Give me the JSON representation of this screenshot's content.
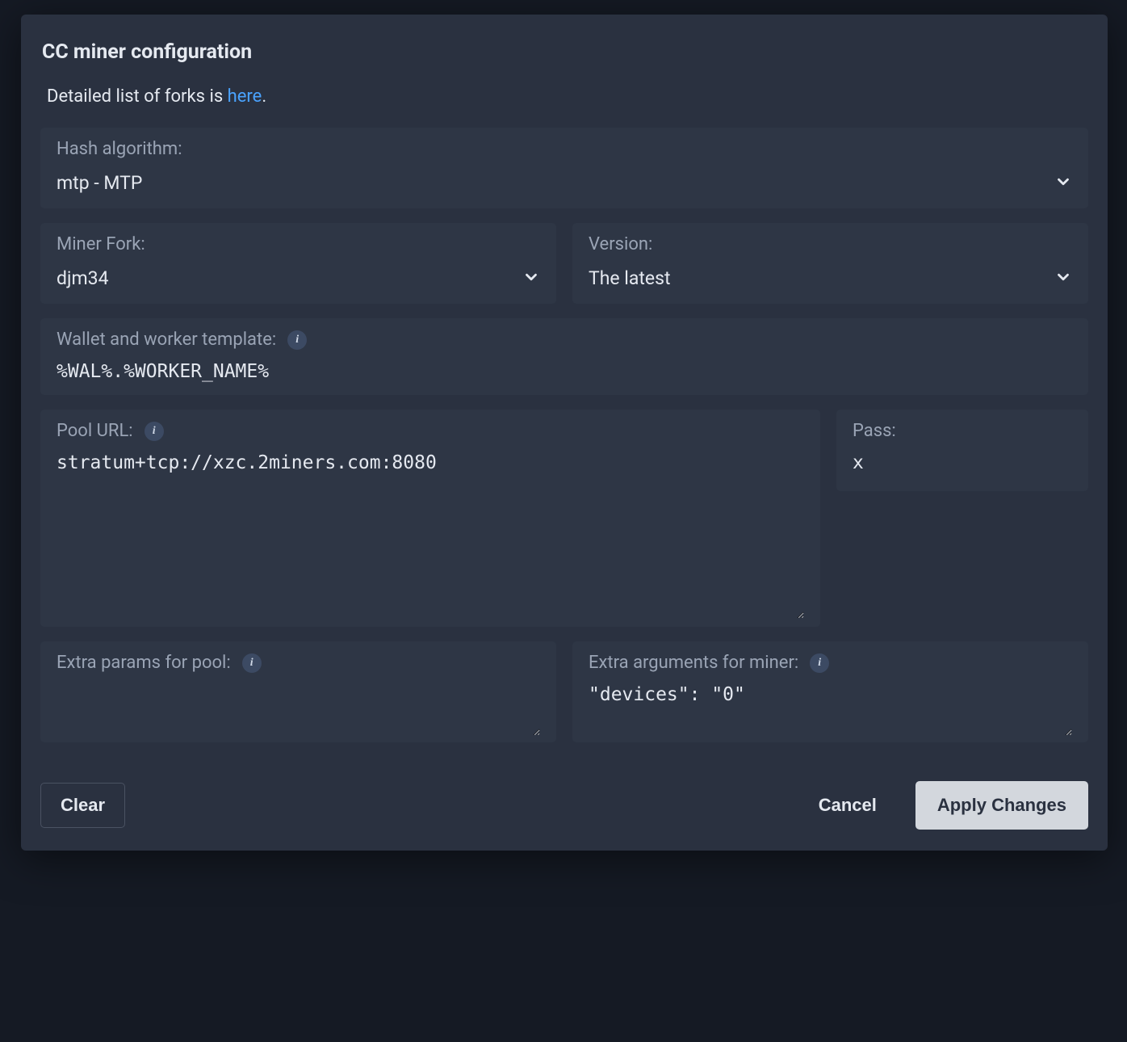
{
  "modal": {
    "title": "CC miner configuration",
    "helper_prefix": "Detailed list of forks is ",
    "helper_link": "here",
    "helper_suffix": "."
  },
  "fields": {
    "hash_algorithm": {
      "label": "Hash algorithm:",
      "value": "mtp - MTP"
    },
    "miner_fork": {
      "label": "Miner Fork:",
      "value": "djm34"
    },
    "version": {
      "label": "Version:",
      "value": "The latest"
    },
    "wallet_template": {
      "label": "Wallet and worker template:",
      "value": "%WAL%.%WORKER_NAME%"
    },
    "pool_url": {
      "label": "Pool URL:",
      "value": "stratum+tcp://xzc.2miners.com:8080"
    },
    "pass": {
      "label": "Pass:",
      "value": "x"
    },
    "extra_pool": {
      "label": "Extra params for pool:",
      "value": ""
    },
    "extra_miner": {
      "label": "Extra arguments for miner:",
      "value": "\"devices\": \"0\""
    }
  },
  "buttons": {
    "clear": "Clear",
    "cancel": "Cancel",
    "apply": "Apply Changes"
  }
}
